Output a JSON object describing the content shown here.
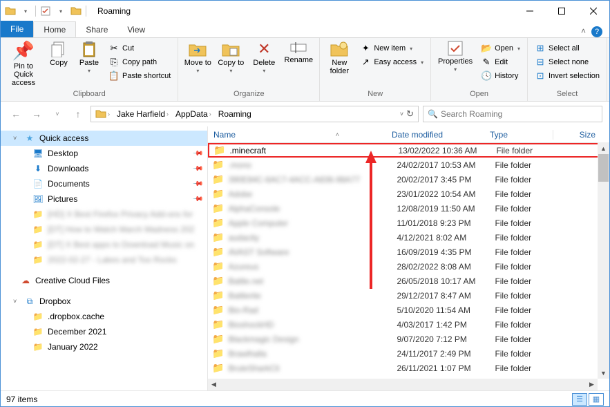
{
  "window": {
    "title": "Roaming"
  },
  "tabs": {
    "file": "File",
    "home": "Home",
    "share": "Share",
    "view": "View"
  },
  "ribbon": {
    "clipboard": {
      "label": "Clipboard",
      "pin": "Pin to Quick access",
      "copy": "Copy",
      "paste": "Paste",
      "cut": "Cut",
      "copy_path": "Copy path",
      "paste_shortcut": "Paste shortcut"
    },
    "organize": {
      "label": "Organize",
      "move_to": "Move to",
      "copy_to": "Copy to",
      "delete": "Delete",
      "rename": "Rename"
    },
    "new": {
      "label": "New",
      "new_folder": "New folder",
      "new_item": "New item",
      "easy_access": "Easy access"
    },
    "open": {
      "label": "Open",
      "properties": "Properties",
      "open": "Open",
      "edit": "Edit",
      "history": "History"
    },
    "select": {
      "label": "Select",
      "select_all": "Select all",
      "select_none": "Select none",
      "invert": "Invert selection"
    }
  },
  "breadcrumb": {
    "p1": "Jake Harfield",
    "p2": "AppData",
    "p3": "Roaming"
  },
  "search": {
    "placeholder": "Search Roaming"
  },
  "columns": {
    "name": "Name",
    "date": "Date modified",
    "type": "Type",
    "size": "Size"
  },
  "nav": {
    "quick_access": "Quick access",
    "desktop": "Desktop",
    "downloads": "Downloads",
    "documents": "Documents",
    "pictures": "Pictures",
    "blur1": "[HD] X Best Firefox Privacy Add-ons for",
    "blur2": "[DT] How to Watch March Madness 202",
    "blur3": "[DT] X Best apps to Download Music on",
    "blur4": "2022-02-27 - Lakes and Too Rocks",
    "ccf": "Creative Cloud Files",
    "dropbox": "Dropbox",
    "dbc": ".dropbox.cache",
    "dec": "December 2021",
    "jan": "January 2022"
  },
  "files": [
    {
      "name": ".minecraft",
      "date": "13/02/2022 10:36 AM",
      "type": "File folder",
      "blur": false
    },
    {
      "name": ".mono",
      "date": "24/02/2017 10:53 AM",
      "type": "File folder",
      "blur": true
    },
    {
      "name": "390E84C-6AC7-4ACC-A836-98A77",
      "date": "20/02/2017 3:45 PM",
      "type": "File folder",
      "blur": true
    },
    {
      "name": "Adobe",
      "date": "23/01/2022 10:54 AM",
      "type": "File folder",
      "blur": true
    },
    {
      "name": "AlphaConsole",
      "date": "12/08/2019 11:50 AM",
      "type": "File folder",
      "blur": true
    },
    {
      "name": "Apple Computer",
      "date": "11/01/2018 9:23 PM",
      "type": "File folder",
      "blur": true
    },
    {
      "name": "audacity",
      "date": "4/12/2021 8:02 AM",
      "type": "File folder",
      "blur": true
    },
    {
      "name": "AVAST Software",
      "date": "16/09/2019 4:35 PM",
      "type": "File folder",
      "blur": true
    },
    {
      "name": "Azureus",
      "date": "28/02/2022 8:08 AM",
      "type": "File folder",
      "blur": true
    },
    {
      "name": "Battle.net",
      "date": "26/05/2018 10:17 AM",
      "type": "File folder",
      "blur": true
    },
    {
      "name": "Battlerite",
      "date": "29/12/2017 8:47 AM",
      "type": "File folder",
      "blur": true
    },
    {
      "name": "Bio-Rad",
      "date": "5/10/2020 11:54 AM",
      "type": "File folder",
      "blur": true
    },
    {
      "name": "BioshockHD",
      "date": "4/03/2017 1:42 PM",
      "type": "File folder",
      "blur": true
    },
    {
      "name": "Blackmagic Design",
      "date": "9/07/2020 7:12 PM",
      "type": "File folder",
      "blur": true
    },
    {
      "name": "Brawlhalla",
      "date": "24/11/2017 2:49 PM",
      "type": "File folder",
      "blur": true
    },
    {
      "name": "BruteSharkCli",
      "date": "26/11/2021 1:07 PM",
      "type": "File folder",
      "blur": true
    }
  ],
  "status": {
    "items": "97 items"
  }
}
